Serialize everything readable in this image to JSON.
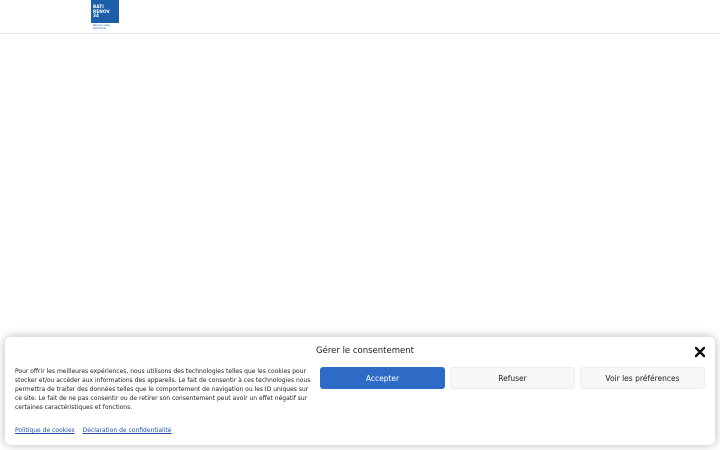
{
  "header": {
    "logo": {
      "line1": "BATI",
      "line2": "RENOV",
      "line3": "34",
      "tagline": "Rénover votre patrimoine"
    }
  },
  "consent": {
    "title": "Gérer le consentement",
    "text": "Pour offrir les meilleures expériences, nous utilisons des technologies telles que les cookies pour stocker et/ou accéder aux informations des appareils. Le fait de consentir à ces technologies nous permettra de traiter des données telles que le comportement de navigation ou les ID uniques sur ce site. Le fait de ne pas consentir ou de retirer son consentement peut avoir un effet négatif sur certaines caractéristiques et fonctions.",
    "buttons": {
      "accept": "Accepter",
      "refuse": "Refuser",
      "preferences": "Voir les préférences"
    },
    "links": {
      "cookie_policy": "Politique de cookies",
      "privacy": "Déclaration de confidentialité"
    },
    "close_icon": "close-icon"
  },
  "colors": {
    "brand": "#1c5fa8",
    "accept_button": "#2e6bc6",
    "secondary_button": "#f7f7f7",
    "link": "#1e4fa8"
  }
}
